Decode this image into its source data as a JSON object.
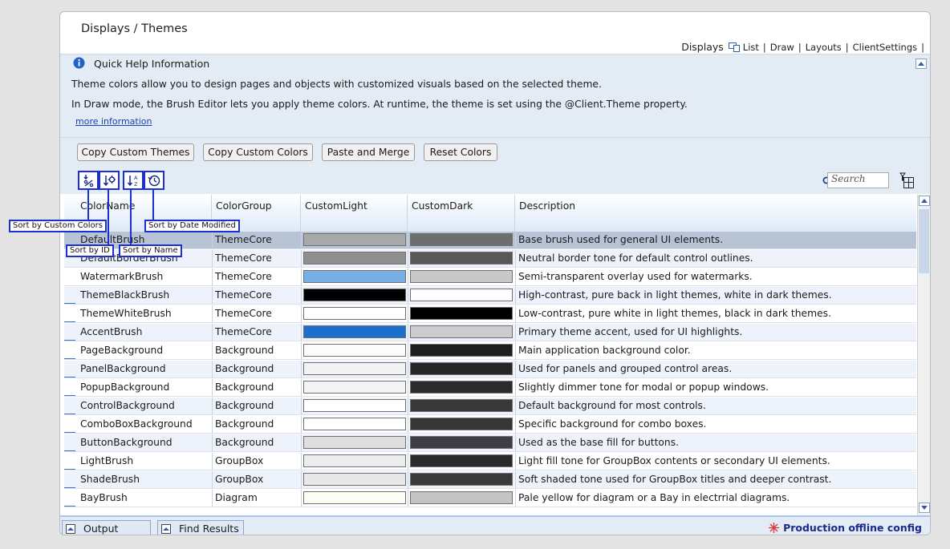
{
  "page": {
    "title": "Displays / Themes"
  },
  "top_nav": {
    "label": "Displays",
    "links": [
      "List",
      "Draw",
      "Layouts",
      "ClientSettings"
    ],
    "separator": "|"
  },
  "help": {
    "title": "Quick Help Information",
    "line1": "Theme colors allow you to design pages and objects with customized visuals based on the selected theme.",
    "line2": "In Draw mode, the Brush Editor lets you apply theme colors. At runtime, the theme is set using the @Client.Theme property.",
    "link": "more information"
  },
  "toolbar": {
    "copy_themes": "Copy Custom Themes",
    "copy_colors": "Copy Custom Colors",
    "paste_merge": "Paste and Merge",
    "reset_colors": "Reset Colors"
  },
  "sort_tooltips": {
    "custom_colors": "Sort by Custom Colors",
    "date_modified": "Sort by Date Modified",
    "id": "Sort by ID",
    "name": "Sort by Name"
  },
  "search": {
    "placeholder": "Search"
  },
  "grid": {
    "columns": [
      "ColorName",
      "ColorGroup",
      "CustomLight",
      "CustomDark",
      "Description"
    ],
    "rows": [
      {
        "name": "DefaultBrush",
        "group": "ThemeCore",
        "light": "#a9a9a9",
        "dark": "#6e6e6e",
        "desc": "Base brush used for general UI elements."
      },
      {
        "name": "DefaultBorderBrush",
        "group": "ThemeCore",
        "light": "#8f8f8f",
        "dark": "#585858",
        "desc": "Neutral border tone for default control outlines."
      },
      {
        "name": "WatermarkBrush",
        "group": "ThemeCore",
        "light": "#78aee6",
        "dark": "#c8c8c8",
        "desc": "Semi-transparent overlay used for watermarks."
      },
      {
        "name": "ThemeBlackBrush",
        "group": "ThemeCore",
        "light": "#000000",
        "dark": "#ffffff",
        "desc": "High-contrast, pure back in light themes, white in dark themes."
      },
      {
        "name": "ThemeWhiteBrush",
        "group": "ThemeCore",
        "light": "#ffffff",
        "dark": "#000000",
        "desc": "Low-contrast, pure white in light themes, black in dark themes."
      },
      {
        "name": "AccentBrush",
        "group": "ThemeCore",
        "light": "#1a6fcf",
        "dark": "#cccccc",
        "desc": "Primary theme accent, used for UI highlights."
      },
      {
        "name": "PageBackground",
        "group": "Background",
        "light": "#fbfbfb",
        "dark": "#1e1e1e",
        "desc": "Main application background color."
      },
      {
        "name": "PanelBackground",
        "group": "Background",
        "light": "#f3f3f3",
        "dark": "#262626",
        "desc": "Used for panels and grouped control areas."
      },
      {
        "name": "PopupBackground",
        "group": "Background",
        "light": "#f4f4f4",
        "dark": "#2b2b2b",
        "desc": "Slightly dimmer tone for modal or popup windows."
      },
      {
        "name": "ControlBackground",
        "group": "Background",
        "light": "#ffffff",
        "dark": "#383838",
        "desc": "Default background for most controls."
      },
      {
        "name": "ComboBoxBackground",
        "group": "Background",
        "light": "#ffffff",
        "dark": "#363636",
        "desc": "Specific background for combo boxes."
      },
      {
        "name": "ButtonBackground",
        "group": "Background",
        "light": "#dedede",
        "dark": "#3d3d48",
        "desc": "Used as the base fill for buttons."
      },
      {
        "name": "LightBrush",
        "group": "GroupBox",
        "light": "#ededed",
        "dark": "#2a2a2a",
        "desc": "Light fill tone for GroupBox contents or secondary UI elements."
      },
      {
        "name": "ShadeBrush",
        "group": "GroupBox",
        "light": "#e8e8e8",
        "dark": "#3a3a3a",
        "desc": "Soft shaded tone used for GroupBox titles and deeper contrast."
      },
      {
        "name": "BayBrush",
        "group": "Diagram",
        "light": "#fcfcf2",
        "dark": "#c4c4c4",
        "desc": "Pale yellow for diagram or a Bay in electrrial diagrams."
      }
    ]
  },
  "bottom": {
    "output": "Output",
    "find_results": "Find Results",
    "status": "Production offline config"
  },
  "colors": {
    "accent": "#1a6fcf",
    "tooltip_border": "#1c2fd6",
    "status_icon": "#d9383a"
  }
}
